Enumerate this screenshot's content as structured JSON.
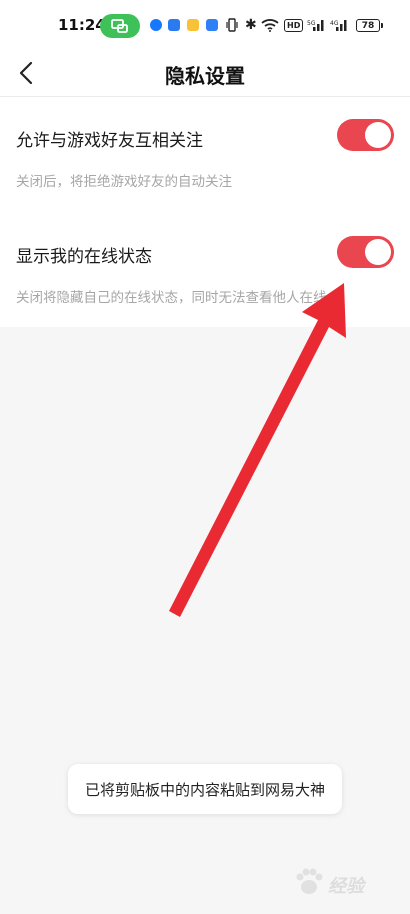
{
  "status_bar": {
    "time": "11:24",
    "battery": "78",
    "network": "HD",
    "accent": "#3fc15a"
  },
  "nav": {
    "back_icon": "chevron-left-icon",
    "title": "隐私设置"
  },
  "settings": [
    {
      "label": "允许与游戏好友互相关注",
      "description": "关闭后，将拒绝游戏好友的自动关注",
      "enabled": true
    },
    {
      "label": "显示我的在线状态",
      "description": "关闭将隐藏自己的在线状态，同时无法查看他人在线",
      "enabled": true
    }
  ],
  "toast": {
    "text": "已将剪贴板中的内容粘贴到网易大神"
  },
  "colors": {
    "toggle_on": "#ea4650",
    "arrow": "#ea2a33",
    "background": "#f6f6f6"
  },
  "watermark": {
    "text": "经验"
  }
}
